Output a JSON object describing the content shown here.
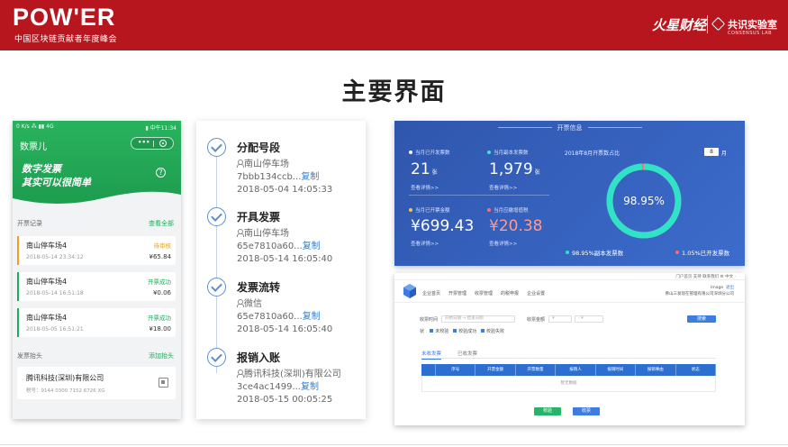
{
  "header": {
    "brand": "POW'ER",
    "brand_sub": "中国区块链贡献者年度峰会",
    "partner_a": "火星财经",
    "partner_b": "共识实验室",
    "partner_b_sub": "CONSENSUS LAB"
  },
  "main_title": "主要界面",
  "phone": {
    "status_left": "0 K/s ⁂ ▮▮ 4G",
    "status_right": "▮ 中午11:34",
    "app_title": "数票儿",
    "capsule_dots": "•••",
    "slogan_line1": "数字发票",
    "slogan_line2": "其实可以很简单",
    "help": "?",
    "records_title": "开票记录",
    "records_link": "查看全部",
    "invoices": [
      {
        "name": "南山停车场4",
        "time": "2018-05-14 23:34:12",
        "status": "待审核",
        "amount": "¥65.84",
        "color": "#f0a020"
      },
      {
        "name": "南山停车场4",
        "time": "2018-05-14 16:51:18",
        "status": "开票成功",
        "amount": "¥0.06",
        "color": "#1aad5a"
      },
      {
        "name": "南山停车场4",
        "time": "2018-05-05 16:51:21",
        "status": "开票成功",
        "amount": "¥18.00",
        "color": "#1aad5a"
      }
    ],
    "titles_title": "发票抬头",
    "titles_link": "添加抬头",
    "company": "腾讯科技(深圳)有限公司",
    "tax_no": "税号：9144 0300 7152 6726 XG"
  },
  "timeline": [
    {
      "step": "分配号段",
      "who": "南山停车场",
      "hash": "7bbb134ccb...",
      "link": "复制",
      "time": "2018-05-04 14:05:33"
    },
    {
      "step": "开具发票",
      "who": "南山停车场",
      "hash": "65e7810a60...",
      "link": "复制",
      "time": "2018-05-14 16:05:40"
    },
    {
      "step": "发票流转",
      "who": "微信",
      "hash": "65e7810a60...",
      "link": "复制",
      "time": "2018-05-14 16:05:40"
    },
    {
      "step": "报销入账",
      "who": "腾讯科技(深圳)有限公司",
      "hash": "3ce4ac1499...",
      "link": "复制",
      "time": "2018-05-15 00:05:25"
    }
  ],
  "dashboard": {
    "title": "开票信息",
    "stats": [
      {
        "label": "当月已开发票数",
        "value": "21",
        "unit": "张",
        "more": "查看详情>>",
        "dot": "#ffffff",
        "color": "#ffffff"
      },
      {
        "label": "当月副本发票数",
        "value": "1,979",
        "unit": "张",
        "more": "查看详情>>",
        "dot": "#3ee6c8",
        "color": "#ffffff"
      },
      {
        "label": "当月已开票金额",
        "value": "¥699.43",
        "unit": "",
        "more": "查看详情>>",
        "dot": "#f6c445",
        "color": "#ffffff"
      },
      {
        "label": "当月应缴增值税",
        "value": "¥20.38",
        "unit": "",
        "more": "查看详情>>",
        "dot": "#ff6b6b",
        "color": "#ff9a8e"
      }
    ],
    "month_label": "2018年8月开票数占比",
    "month_value": "8",
    "month_unit": "月",
    "ring_percent": 98.95,
    "ring_label": "98.95%",
    "legend_a": "98.95%副本发票数",
    "legend_b": "1.05%已开发票数",
    "ring_color": "#2fe3c7",
    "ring_rest_color": "#ff6b6b"
  },
  "desktop": {
    "top_links": "门户首页    支持    联系我们    ⚙    中文 ·",
    "nav": [
      "企业首页",
      "开票管理",
      "收票管理",
      "的税申报",
      "企业设置"
    ],
    "user_name": "Image",
    "user_exit": "退出",
    "user_company": "佛山三发现在管理有限公司深圳分公司",
    "f_time_label": "收票时间",
    "f_start": "开始日期",
    "f_to": "→",
    "f_end": "结束日期",
    "f_amount_label": "收票金额",
    "f_amount_unit": "¥",
    "f_amount_to": "- ¥",
    "f_status_label": "状",
    "f_checks": [
      "未校验",
      "校验成功",
      "校验失败"
    ],
    "search": "搜索",
    "tab_active": "未收发票",
    "tab_other": "已收发票",
    "columns": [
      "",
      "序号",
      "开票金额",
      "开票数量",
      "报销人",
      "报销时间",
      "报销事由",
      "状态"
    ],
    "empty": "暂无数据",
    "btn_check": "校验",
    "btn_receive": "收票"
  }
}
